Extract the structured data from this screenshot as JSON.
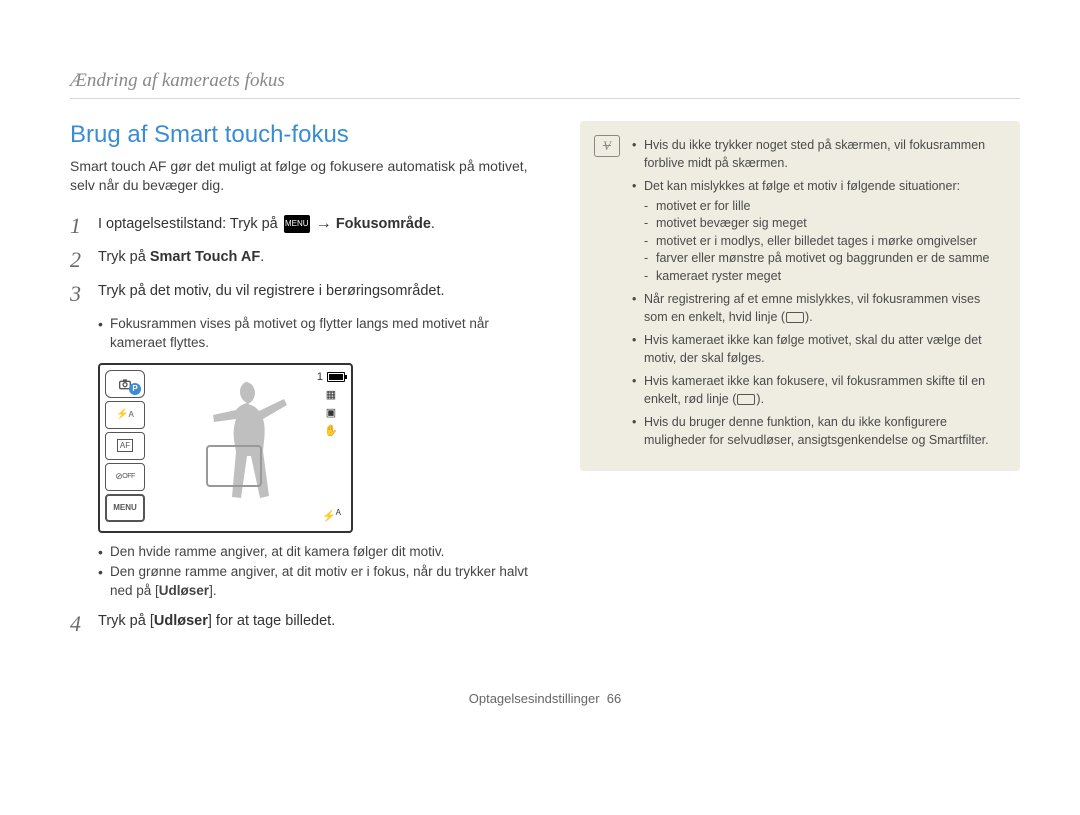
{
  "header": "Ændring af kameraets fokus",
  "section_title": "Brug af Smart touch-fokus",
  "intro": "Smart touch AF gør det muligt at følge og fokusere automatisk på motivet, selv når du bevæger dig.",
  "steps": {
    "s1": {
      "num": "1",
      "pre": "I optagelsestilstand: Tryk på ",
      "menu": "MENU",
      "arrow": "→",
      "post": "Fokusområde",
      "dot": "."
    },
    "s2": {
      "num": "2",
      "pre": "Tryk på ",
      "bold": "Smart Touch AF",
      "dot": "."
    },
    "s3": {
      "num": "3",
      "text": "Tryk på det motiv, du vil registrere i berøringsområdet."
    },
    "s3_sub": [
      "Fokusrammen vises på motivet og flytter langs med motivet når kameraet flyttes."
    ],
    "s3_sub2": [
      "Den hvide ramme angiver, at dit kamera følger dit motiv.",
      "Den grønne ramme angiver, at dit motiv er i fokus, når du trykker halvt ned på [Udløser]."
    ],
    "s4": {
      "num": "4",
      "pre": "Tryk på [",
      "bold": "Udløser",
      "post": "] for at tage billedet."
    }
  },
  "screen": {
    "mode_letter": "P",
    "flash": "A",
    "af": "AF",
    "off": "OFF",
    "menu": "MENU",
    "count": "1",
    "bottom_flash": "A"
  },
  "notes": [
    {
      "text": "Hvis du ikke trykker noget sted på skærmen, vil fokusrammen forblive midt på skærmen."
    },
    {
      "text": "Det kan mislykkes at følge et motiv i følgende situationer:",
      "sub": [
        "motivet er for lille",
        "motivet bevæger sig meget",
        "motivet er i modlys, eller billedet tages i mørke omgivelser",
        "farver eller mønstre på motivet og baggrunden er de samme",
        "kameraet ryster meget"
      ]
    },
    {
      "text_pre": "Når registrering af et emne mislykkes, vil fokusrammen vises som en enkelt, hvid linje (",
      "text_post": ").",
      "rect": true
    },
    {
      "text": "Hvis kameraet ikke kan følge motivet, skal du atter vælge det motiv, der skal følges."
    },
    {
      "text_pre": "Hvis kameraet ikke kan fokusere, vil fokusrammen skifte til en enkelt, rød linje (",
      "text_post": ").",
      "rect": true
    },
    {
      "text": "Hvis du bruger denne funktion, kan du ikke konfigurere muligheder for selvudløser, ansigtsgenkendelse og Smartfilter."
    }
  ],
  "footer": {
    "section": "Optagelsesindstillinger",
    "page": "66"
  }
}
